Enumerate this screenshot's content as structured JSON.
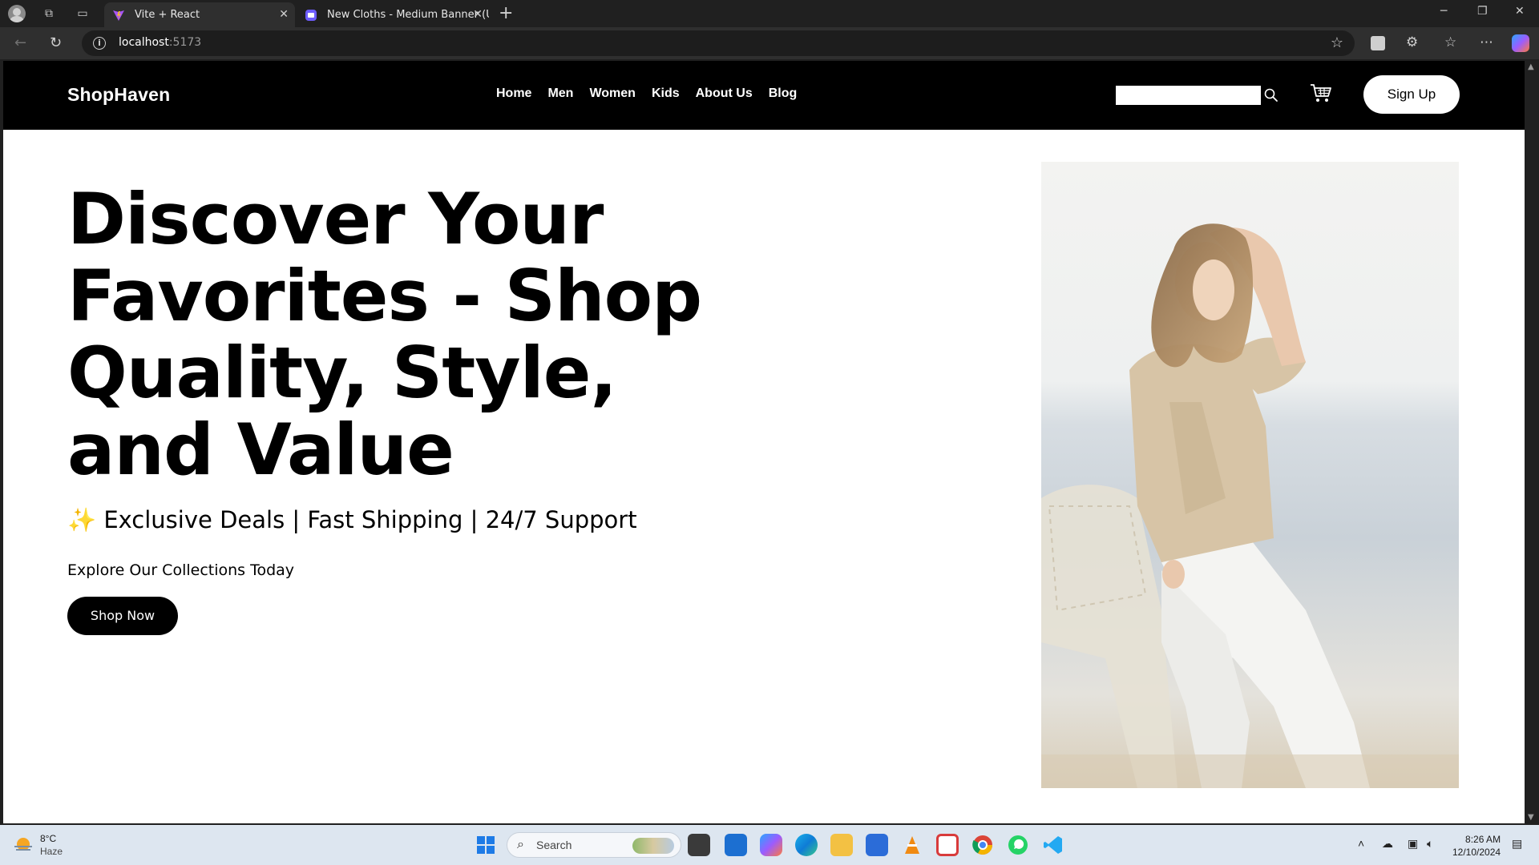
{
  "browser": {
    "tabs": [
      {
        "title": "Vite + React",
        "active": true
      },
      {
        "title": "New Cloths - Medium Banner (US",
        "active": false
      }
    ],
    "url_host": "localhost",
    "url_port": ":5173"
  },
  "site": {
    "logo": "ShopHaven",
    "nav": [
      "Home",
      "Men",
      "Women",
      "Kids",
      "About Us",
      "Blog"
    ],
    "search_placeholder": "",
    "signup_label": "Sign Up"
  },
  "hero": {
    "title": "Discover Your Favorites - Shop Quality, Style, and Value",
    "sparkle": "✨",
    "tagline": "Exclusive Deals | Fast Shipping | 24/7 Support",
    "explore": "Explore Our Collections Today",
    "cta": "Shop Now"
  },
  "taskbar": {
    "weather_temp": "8°C",
    "weather_cond": "Haze",
    "search_label": "Search",
    "time": "8:26 AM",
    "date": "12/10/2024"
  },
  "colors": {
    "header_bg": "#000000",
    "page_bg": "#ffffff",
    "cta_bg": "#000000",
    "chrome_bg": "#202020"
  }
}
